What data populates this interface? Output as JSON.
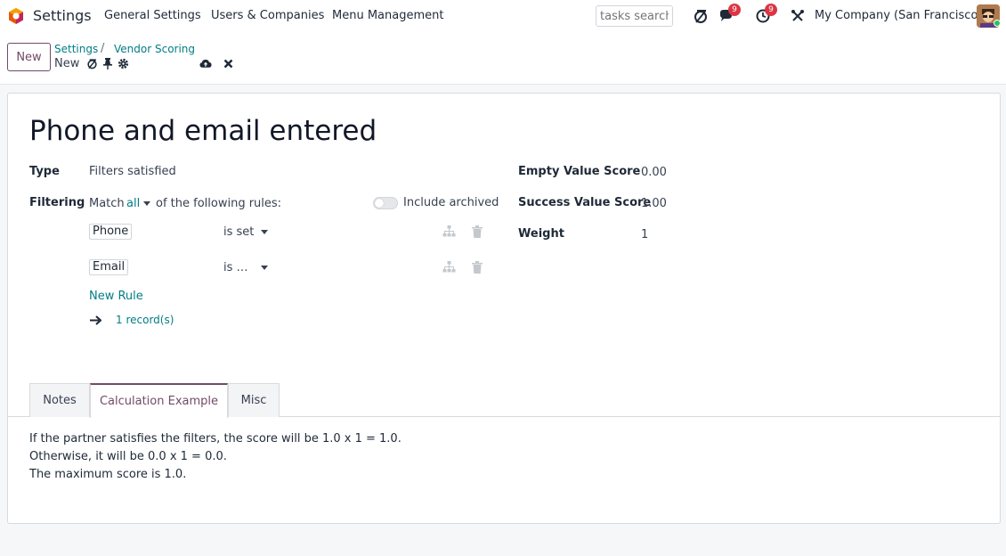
{
  "navbar": {
    "app_name": "Settings",
    "menu": [
      "General Settings",
      "Users & Companies",
      "Menu Management"
    ],
    "search_placeholder": "tasks search",
    "messages_count": "9",
    "activities_count": "9",
    "company": "My Company (San Francisco)"
  },
  "control": {
    "new_label": "New",
    "breadcrumb_parent": "Settings",
    "breadcrumb_separator": "/",
    "breadcrumb_current": "Vendor Scoring",
    "record_name": "New"
  },
  "form": {
    "title": "Phone and email entered",
    "type_label": "Type",
    "type_value": "Filters satisfied",
    "filtering_label": "Filtering",
    "match_prefix": "Match",
    "match_value": "all",
    "match_suffix": "of the following rules:",
    "include_archived": "Include archived",
    "rules": [
      {
        "field": "Phone",
        "operator": "is set"
      },
      {
        "field": "Email",
        "operator": "is …"
      }
    ],
    "new_rule": "New Rule",
    "records": "1 record(s)",
    "empty_score_label": "Empty Value Score",
    "empty_score_value": "0.00",
    "success_score_label": "Success Value Score",
    "success_score_value": "1.00",
    "weight_label": "Weight",
    "weight_value": "1"
  },
  "tabs": {
    "items": [
      "Notes",
      "Calculation Example",
      "Misc"
    ],
    "active": "Calculation Example"
  },
  "calculation": {
    "line1": "If the partner satisfies the filters, the score will be 1.0 x 1 = 1.0.",
    "line2": "Otherwise, it will be 0.0 x 1 = 0.0.",
    "line3": "The maximum score is 1.0."
  },
  "colors": {
    "brand": "#714b67",
    "link": "#017e84",
    "badge": "#dc3545"
  }
}
